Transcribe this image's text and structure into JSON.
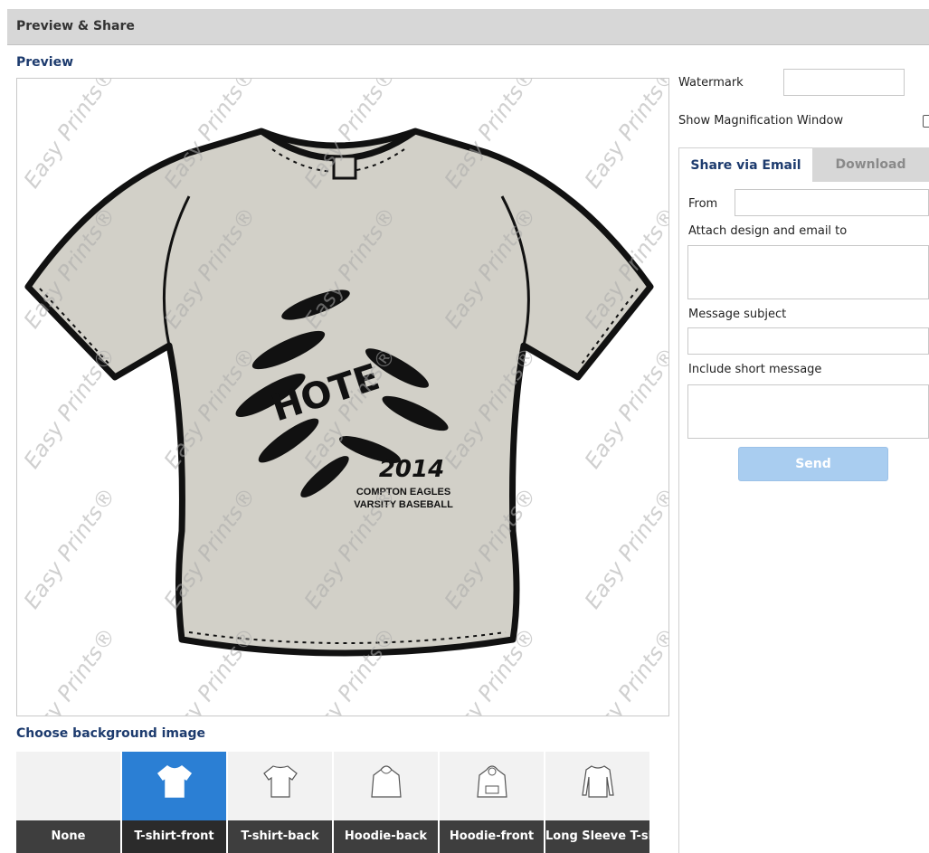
{
  "header": {
    "title": "Preview & Share"
  },
  "preview": {
    "label": "Preview",
    "watermark_text": "Easy Prints®",
    "design": {
      "line1": "HOTE",
      "year": "2014",
      "team": "COMPTON EAGLES",
      "squad": "VARSITY BASEBALL"
    },
    "shirt_color": "#d2d0c8"
  },
  "background": {
    "label": "Choose background image",
    "tiles": [
      {
        "label": "None",
        "selected": false
      },
      {
        "label": "T-shirt-front",
        "selected": true
      },
      {
        "label": "T-shirt-back",
        "selected": false
      },
      {
        "label": "Hoodie-back",
        "selected": false
      },
      {
        "label": "Hoodie-front",
        "selected": false
      },
      {
        "label": "Long Sleeve T-sh",
        "selected": false
      }
    ]
  },
  "right": {
    "watermark_label": "Watermark",
    "watermark_value": "",
    "magnify_label": "Show Magnification Window",
    "tabs": {
      "email": "Share via Email",
      "download": "Download"
    },
    "from_label": "From",
    "attach_label": "Attach design and email to",
    "subject_label": "Message subject",
    "message_label": "Include short message",
    "send_label": "Send"
  },
  "colors": {
    "accent": "#2b7fd4",
    "heading": "#1d3b6e",
    "send_disabled": "#a9cdf0"
  }
}
